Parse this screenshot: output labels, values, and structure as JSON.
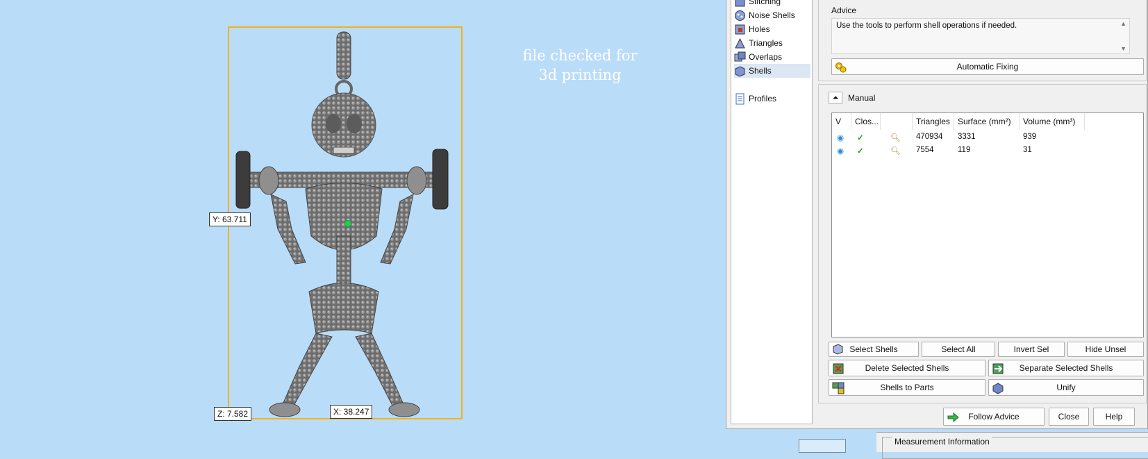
{
  "viewport": {
    "overlay_title_line1": "file checked for",
    "overlay_title_line2": "3d printing",
    "dim_y": "Y: 63.711",
    "dim_z": "Z: 7.582",
    "dim_x": "X: 38.247",
    "bbox_color": "#f2b21d"
  },
  "nav": {
    "items": [
      {
        "label": "Stitching",
        "icon": "stitching-icon"
      },
      {
        "label": "Noise Shells",
        "icon": "noise-shells-icon"
      },
      {
        "label": "Holes",
        "icon": "holes-icon"
      },
      {
        "label": "Triangles",
        "icon": "triangles-icon"
      },
      {
        "label": "Overlaps",
        "icon": "overlaps-icon"
      },
      {
        "label": "Shells",
        "icon": "shells-icon",
        "selected": true
      }
    ],
    "profiles_label": "Profiles"
  },
  "advice": {
    "title": "Advice",
    "text": "Use the tools to perform shell operations if needed.",
    "auto_fix_label": "Automatic Fixing"
  },
  "manual": {
    "label": "Manual",
    "columns": [
      "V",
      "Clos...",
      "",
      "Triangles",
      "Surface (mm²)",
      "Volume (mm³)"
    ],
    "rows": [
      {
        "triangles": "470934",
        "surface": "3331",
        "volume": "939"
      },
      {
        "triangles": "7554",
        "surface": "119",
        "volume": "31"
      }
    ]
  },
  "buttons": {
    "select_shells": "Select Shells",
    "select_all": "Select All",
    "invert_sel": "Invert Sel",
    "hide_unsel": "Hide Unsel",
    "delete_selected": "Delete Selected Shells",
    "separate_selected": "Separate Selected Shells",
    "shells_to_parts": "Shells to Parts",
    "unify": "Unify",
    "follow_advice": "Follow Advice",
    "close": "Close",
    "help": "Help"
  },
  "measurement": {
    "title": "Measurement Information"
  }
}
